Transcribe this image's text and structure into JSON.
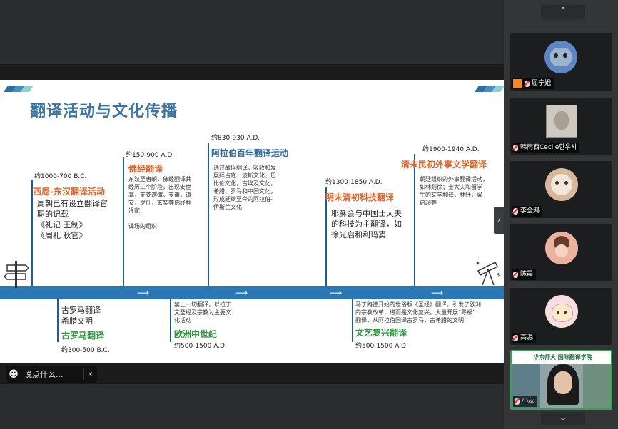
{
  "slide": {
    "title": "翻译活动与文化传播",
    "events": [
      {
        "date": "约1000-700 B.C.",
        "era": "西周-东汉翻译活动",
        "desc_lines": [
          "周朝已有设立翻译官",
          "职的记载",
          "《礼记 王制》",
          "《周礼 秋官》"
        ]
      },
      {
        "date": "约150-900 A.D.",
        "era": "佛经翻译",
        "desc_lines": [
          "东汉至唐朝，佛经翻译共",
          "经历三个阶段，出现安世",
          "高，支娄迦谶，支谦，道",
          "安，罗什，玄奘等佛经翻",
          "译家",
          "",
          "译场的组织"
        ]
      },
      {
        "date": "约830-930 A.D.",
        "era": "阿拉伯百年翻译运动",
        "desc_lines": [
          "通过战俘翻译，吸收和发",
          "展拜占庭、波斯文化、巴",
          "比伦文化，古埃及文化，",
          "希腊、罗马和中国文化，",
          "形成延续至今的阿拉伯-",
          "伊斯兰文化"
        ]
      },
      {
        "date": "约1300-1850 A.D.",
        "era": "明末清初科技翻译",
        "desc_lines": [
          "耶稣会与中国士大夫",
          "的科技为主翻译，如",
          "徐光启和利玛窦"
        ]
      },
      {
        "date": "约1900-1940 A.D.",
        "era": "清末民初外事文学翻译",
        "desc_lines": [
          "朝廷组织的外事翻译活动，",
          "如林则徐；士大夫和留学",
          "生的文学翻译，林纾，梁",
          "启超等"
        ]
      },
      {
        "date": "约300-500 B.C.",
        "era": "古罗马翻译",
        "desc_lines": [
          "古罗马翻译",
          "希腊文明"
        ]
      },
      {
        "date": "约500-1500 A.D.",
        "era": "欧洲中世纪",
        "desc_lines": [
          "禁止一切翻译，以拉丁",
          "文圣经及宗教为主要文",
          "化活动"
        ]
      },
      {
        "date": "约500-1500 A.D.",
        "era": "文艺复兴翻译",
        "desc_lines": [
          "马丁路德开始的世俗版《圣经》翻译，引发了欧洲",
          "的宗教改革，进而是文化复兴，大量开展“寻根”",
          "翻译，从阿拉伯国译古罗马，古希腊的文明"
        ]
      }
    ]
  },
  "chat": {
    "placeholder": "说点什么..."
  },
  "participants": [
    {
      "name": "屈宁娥"
    },
    {
      "name": "韩雨西Cecile한우시"
    },
    {
      "name": "李全鸿"
    },
    {
      "name": "陈晨"
    },
    {
      "name": "高源"
    },
    {
      "name": "小灰",
      "banner": "华东师大 国际翻译学院"
    }
  ],
  "colors": {
    "accent_blue": "#2b77b1",
    "orange": "#e0632c",
    "green": "#2f9a3f",
    "active_border": "#2fa84f"
  }
}
